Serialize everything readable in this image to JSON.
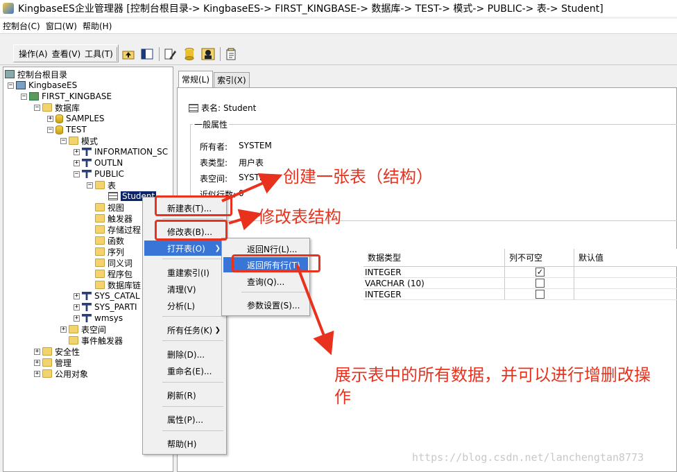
{
  "window": {
    "title": "KingbaseES企业管理器 [控制台根目录-> KingbaseES-> FIRST_KINGBASE-> 数据库-> TEST-> 模式-> PUBLIC-> 表-> Student]"
  },
  "menubar": [
    "控制台(C)",
    "窗口(W)",
    "帮助(H)"
  ],
  "toolbar": {
    "menus": [
      "操作(A)",
      "查看(V)",
      "工具(T)"
    ],
    "icons": [
      "up-folder-icon",
      "show-hide-tree-icon",
      "sql-editor-icon",
      "database-icon",
      "user-security-icon",
      "properties-icon"
    ]
  },
  "tree": {
    "root": "控制台根目录",
    "kingbase": "KingbaseES",
    "server": "FIRST_KINGBASE",
    "databases": "数据库",
    "samples": "SAMPLES",
    "test": "TEST",
    "schemas": "模式",
    "information_schema": "INFORMATION_SC",
    "outln": "OUTLN",
    "public": "PUBLIC",
    "tables": "表",
    "student": "Student",
    "views": "视图",
    "triggers": "触发器",
    "procedures": "存储过程",
    "functions": "函数",
    "sequences": "序列",
    "synonyms": "同义词",
    "packages": "程序包",
    "db_links": "数据库链",
    "sys_catalog": "SYS_CATAL",
    "sys_partition": "SYS_PARTI",
    "wmsys": "wmsys",
    "tablespaces": "表空间",
    "event_triggers": "事件触发器",
    "security": "安全性",
    "management": "管理",
    "public_objects": "公用对象"
  },
  "tabs": [
    "常规(L)",
    "索引(X)"
  ],
  "detail": {
    "table_name_label": "表名:",
    "table_name": "Student",
    "group_title": "一般属性",
    "owner_label": "所有者:",
    "owner": "SYSTEM",
    "type_label": "表类型:",
    "type": "用户表",
    "tablespace_label": "表空间:",
    "tablespace": "SYSTE",
    "rowcount_label": "近似行数:",
    "rowcount": "0"
  },
  "columns_grid": {
    "headers": [
      "数据类型",
      "列不可空",
      "默认值"
    ],
    "rows": [
      {
        "type": "INTEGER",
        "not_null": "✓"
      },
      {
        "type": "VARCHAR (10)",
        "not_null": ""
      },
      {
        "type": "INTEGER",
        "not_null": ""
      }
    ]
  },
  "context_menu": {
    "new_table": "新建表(T)...",
    "modify_table": "修改表(B)...",
    "open_table": "打开表(O)",
    "rebuild_index": "重建索引(I)",
    "clean": "清理(V)",
    "analyze": "分析(L)",
    "all_tasks": "所有任务(K)",
    "delete": "删除(D)...",
    "rename": "重命名(E)...",
    "refresh": "刷新(R)",
    "properties": "属性(P)...",
    "help": "帮助(H)"
  },
  "submenu": {
    "return_n_rows": "返回N行(L)...",
    "return_all_rows": "返回所有行(T)",
    "query": "查询(Q)...",
    "param_settings": "参数设置(S)..."
  },
  "annotations": {
    "create_table": "创建一张表（结构）",
    "modify_structure": "修改表结构",
    "show_all_line1": "展示表中的所有数据，并可以进行增删改操",
    "show_all_line2": "作",
    "color": "#e8321e"
  },
  "watermark": "https://blog.csdn.net/lanchengtan8773"
}
